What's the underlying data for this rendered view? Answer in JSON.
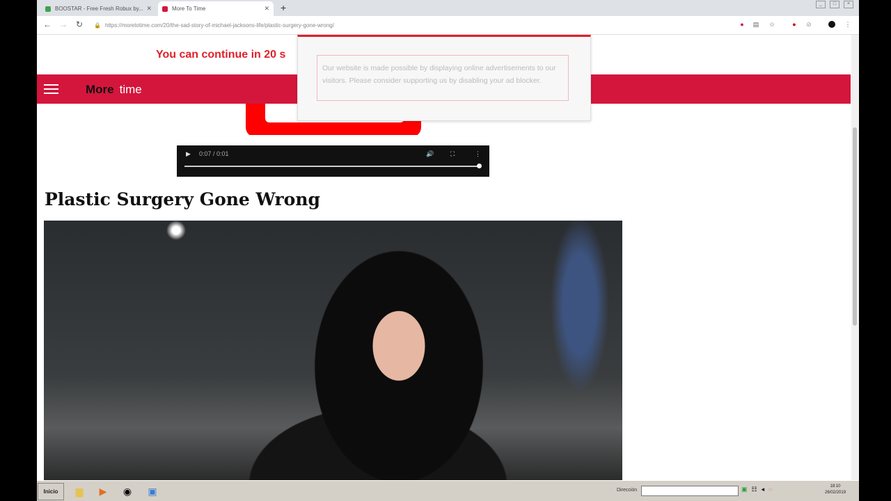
{
  "browser": {
    "tabs": [
      {
        "label": "BOOSTAR - Free Fresh Robux by...",
        "favicon_color": "#3fa34d"
      },
      {
        "label": "More To Time",
        "favicon_color": "#d4163c"
      }
    ],
    "new_tab_symbol": "+",
    "url": "https://moretotime.com/20/the-sad-story-of-michael-jacksons-life/plastic-surgery-gone-wrong/",
    "window_controls": [
      "_",
      "□",
      "×"
    ]
  },
  "page": {
    "countdown_text": "You can continue in 20 s",
    "logo": {
      "part1": "More",
      "part2": "time"
    },
    "video": {
      "time": "0:07 / 0:01"
    },
    "heading": "Plastic Surgery Gone Wrong",
    "popup_message": "Our website is made possible by displaying online advertisements to our visitors. Please consider supporting us by disabling your ad blocker."
  },
  "taskbar": {
    "start_label": "Inicio",
    "address_label": "Dirección",
    "clock": {
      "time": "18:10",
      "date": "26/02/2019"
    }
  },
  "colors": {
    "brand": "#d4163c",
    "countdown": "#e0202a"
  }
}
